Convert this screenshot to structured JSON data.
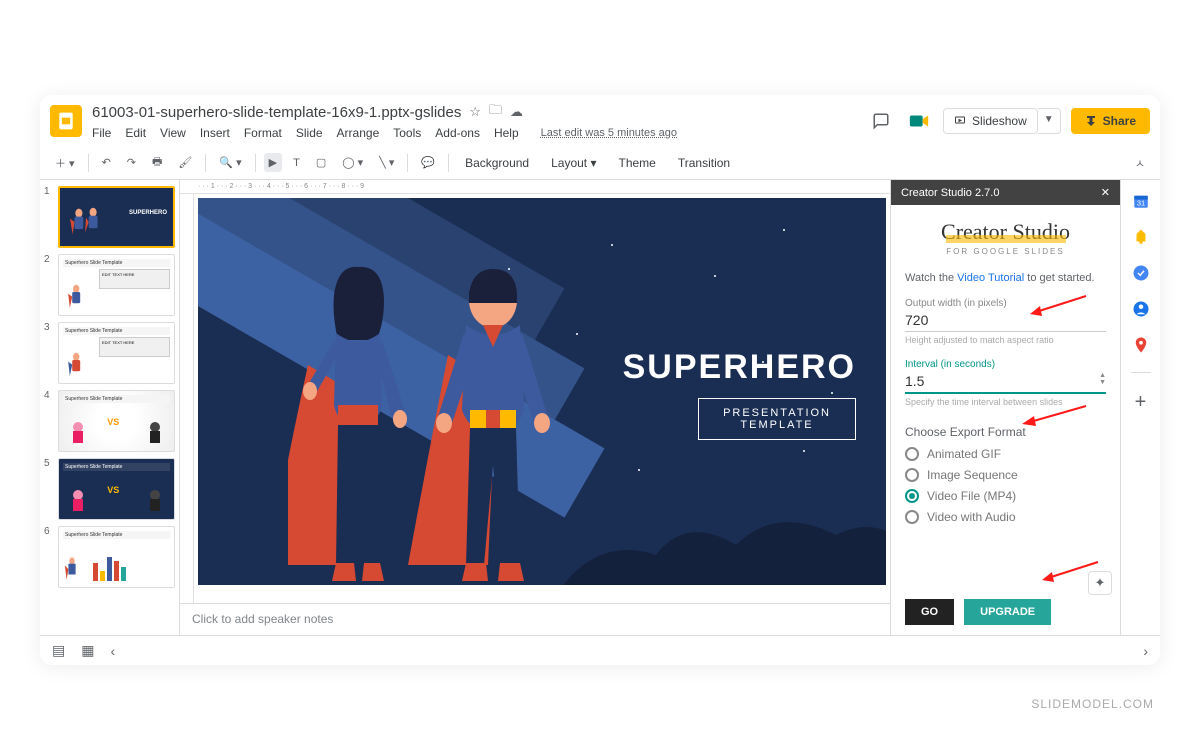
{
  "header": {
    "filename": "61003-01-superhero-slide-template-16x9-1.pptx-gslides",
    "menus": [
      "File",
      "Edit",
      "View",
      "Insert",
      "Format",
      "Slide",
      "Arrange",
      "Tools",
      "Add-ons",
      "Help"
    ],
    "last_edit": "Last edit was 5 minutes ago",
    "slideshow": "Slideshow",
    "share": "Share"
  },
  "toolbar": {
    "background": "Background",
    "layout": "Layout",
    "theme": "Theme",
    "transition": "Transition"
  },
  "thumbs": [
    1,
    2,
    3,
    4,
    5,
    6
  ],
  "thumb_labels": {
    "t1": "SUPERHERO",
    "header": "Superhero Slide Template",
    "body_title": "EDIT TEXT HERE",
    "vs": "VS"
  },
  "slide": {
    "title": "SUPERHERO",
    "sub1": "PRESENTATION",
    "sub2": "TEMPLATE"
  },
  "notes_placeholder": "Click to add speaker notes",
  "sidebar": {
    "title": "Creator Studio 2.7.0",
    "brand": "Creator Studio",
    "brand_sub": "FOR GOOGLE SLIDES",
    "watch_pre": "Watch the ",
    "watch_link": "Video Tutorial",
    "watch_post": " to get started.",
    "width_label": "Output width (in pixels)",
    "width_value": "720",
    "width_help": "Height adjusted to match aspect ratio",
    "interval_label": "Interval (in seconds)",
    "interval_value": "1.5",
    "interval_help": "Specify the time interval between slides",
    "export_title": "Choose Export Format",
    "opt1": "Animated GIF",
    "opt2": "Image Sequence",
    "opt3": "Video File (MP4)",
    "opt4": "Video with Audio",
    "go": "GO",
    "upgrade": "UPGRADE"
  },
  "watermark": "SLIDEMODEL.COM"
}
